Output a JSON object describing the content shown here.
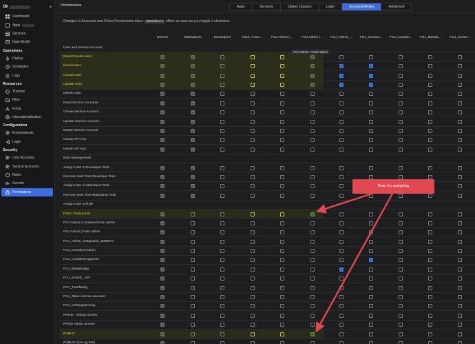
{
  "brand": {
    "logo": "Ok"
  },
  "sidebar": {
    "sections": [
      {
        "items": [
          {
            "label": "Dashboard",
            "icon": "grid-icon"
          },
          {
            "label": "Apps",
            "icon": "apps-icon",
            "blurred": true
          },
          {
            "label": "Services",
            "icon": "server-icon"
          },
          {
            "label": "Data Model",
            "icon": "database-icon"
          }
        ]
      },
      {
        "title": "Operations",
        "items": [
          {
            "label": "Deploy",
            "icon": "rocket-icon"
          },
          {
            "label": "Schedules",
            "icon": "clock-icon"
          },
          {
            "label": "Logs",
            "icon": "list-icon"
          }
        ]
      },
      {
        "title": "Resources",
        "items": [
          {
            "label": "Themes",
            "icon": "palette-icon"
          },
          {
            "label": "Files",
            "icon": "folder-icon"
          },
          {
            "label": "Fonts",
            "icon": "font-icon"
          },
          {
            "label": "Internationalization",
            "icon": "globe-icon"
          }
        ]
      },
      {
        "title": "Configuration",
        "items": [
          {
            "label": "Environments",
            "icon": "layers-icon"
          },
          {
            "label": "Login",
            "icon": "login-icon"
          }
        ]
      },
      {
        "title": "Security",
        "items": [
          {
            "label": "User Accounts",
            "icon": "users-icon"
          },
          {
            "label": "Service Accounts",
            "icon": "users-icon"
          },
          {
            "label": "Roles",
            "icon": "shield-icon"
          },
          {
            "label": "Secrets",
            "icon": "key-icon"
          },
          {
            "label": "Permissions",
            "icon": "lock-icon",
            "active": true
          }
        ]
      }
    ]
  },
  "header": {
    "title": "Permissions"
  },
  "tabs": [
    {
      "label": "Apps"
    },
    {
      "label": "Services"
    },
    {
      "label": "Object Classes"
    },
    {
      "label": "Login"
    },
    {
      "label": "Accounts/Roles",
      "active": true
    },
    {
      "label": "Advanced"
    }
  ],
  "notice": {
    "before": "Changes in Accounts and Roles Permissions takes",
    "code": "immediate",
    "after": "effect as soon as you toggle a checkbox."
  },
  "columns": [
    "Owners",
    "Maintainers",
    "Developers",
    "Fasit | Fasit ...",
    "FGJ Admin | ...",
    "FGJ Admin | ...",
    "FGJ_Admin_...",
    "FGJ_Contain...",
    "FGJ_Contain...",
    "FGJ_Mottak...",
    "FGJ_Sortert..."
  ],
  "tooltip": "FGJ Admin | Fasit admin",
  "colors": {
    "accent": "#3d6be0",
    "highlight_text": "#e4d84a",
    "annotation": "#e24851"
  },
  "rows": [
    {
      "label": "User and Service Account",
      "type": "section"
    },
    {
      "label": "Read Create Users",
      "hl": "full",
      "cells": [
        "d",
        "d",
        "o",
        "y",
        "y",
        "d",
        "o",
        "o",
        "o",
        "o",
        "o"
      ]
    },
    {
      "label": "Read Users",
      "hl": "full",
      "cells": [
        "d",
        "d",
        "o",
        "y",
        "y",
        "d",
        "b",
        "b",
        "o",
        "o",
        "o"
      ]
    },
    {
      "label": "Create User",
      "hl": "full",
      "cells": [
        "d",
        "d",
        "o",
        "y",
        "y",
        "d",
        "b",
        "b",
        "o",
        "o",
        "o"
      ]
    },
    {
      "label": "Update User",
      "hl": "full",
      "cells": [
        "d",
        "d",
        "o",
        "y",
        "y",
        "d",
        "b",
        "b",
        "o",
        "o",
        "o"
      ]
    },
    {
      "label": "Delete User",
      "cells": [
        "d",
        "d",
        "o",
        "o",
        "o",
        "o",
        "o",
        "o",
        "o",
        "o",
        "o"
      ]
    },
    {
      "label": "Read Service Accounts",
      "cells": [
        "d",
        "d",
        "o",
        "o",
        "o",
        "o",
        "o",
        "o",
        "o",
        "o",
        "o"
      ]
    },
    {
      "label": "Create Service Account",
      "cells": [
        "d",
        "d",
        "o",
        "o",
        "o",
        "o",
        "o",
        "o",
        "o",
        "o",
        "o"
      ]
    },
    {
      "label": "Update Service Account",
      "cells": [
        "d",
        "d",
        "o",
        "o",
        "o",
        "o",
        "o",
        "o",
        "o",
        "o",
        "o"
      ]
    },
    {
      "label": "Delete Service Account",
      "cells": [
        "d",
        "d",
        "o",
        "o",
        "o",
        "o",
        "o",
        "o",
        "o",
        "o",
        "o"
      ]
    },
    {
      "label": "Create API Key",
      "cells": [
        "d",
        "d",
        "o",
        "o",
        "o",
        "o",
        "o",
        "o",
        "o",
        "o",
        "o"
      ]
    },
    {
      "label": "Delete API Key",
      "cells": [
        "d",
        "d",
        "o",
        "o",
        "o",
        "o",
        "o",
        "o",
        "o",
        "o",
        "o"
      ]
    },
    {
      "label": "Role Management",
      "type": "section"
    },
    {
      "label": "Assign User to Developer Role",
      "cells": [
        "d",
        "d",
        "o",
        "o",
        "o",
        "o",
        "o",
        "o",
        "o",
        "o",
        "o"
      ]
    },
    {
      "label": "Remove User from Developer Role",
      "cells": [
        "d",
        "d",
        "o",
        "o",
        "o",
        "o",
        "o",
        "o",
        "o",
        "o",
        "o"
      ]
    },
    {
      "label": "Assign User to Maintainer Role",
      "cells": [
        "d",
        "d",
        "o",
        "o",
        "o",
        "o",
        "o",
        "o",
        "o",
        "o",
        "o"
      ]
    },
    {
      "label": "Remove User from Maintainer Role",
      "cells": [
        "d",
        "d",
        "o",
        "o",
        "o",
        "o",
        "o",
        "o",
        "o",
        "o",
        "o"
      ]
    },
    {
      "label": "Assign User to Role",
      "type": "section"
    },
    {
      "label": "Fasit | Fasit portal",
      "hl": "sel",
      "cells": [
        "d",
        "o",
        "o",
        "y",
        "y",
        "g",
        "o",
        "o",
        "o",
        "o",
        "o"
      ]
    },
    {
      "label": "FGJ Admin | ContainerScan admin",
      "cells": [
        "d",
        "o",
        "o",
        "o",
        "o",
        "o",
        "o",
        "o",
        "o",
        "o",
        "o"
      ]
    },
    {
      "label": "FGJ Admin | Fasit admin",
      "cells": [
        "d",
        "o",
        "o",
        "o",
        "o",
        "o",
        "o",
        "o",
        "o",
        "o",
        "o"
      ]
    },
    {
      "label": "FGJ_Admin_Integration_D365FO",
      "cells": [
        "d",
        "o",
        "o",
        "o",
        "o",
        "o",
        "o",
        "o",
        "o",
        "o",
        "o"
      ]
    },
    {
      "label": "FGJ_ContainerAdmin",
      "cells": [
        "d",
        "o",
        "o",
        "o",
        "o",
        "o",
        "o",
        "o",
        "o",
        "o",
        "o"
      ]
    },
    {
      "label": "FGJ_ContainerAppUser",
      "cells": [
        "d",
        "o",
        "o",
        "o",
        "o",
        "o",
        "o",
        "b",
        "o",
        "o",
        "o"
      ]
    },
    {
      "label": "FGJ_Mottaksapp",
      "cells": [
        "d",
        "o",
        "o",
        "o",
        "o",
        "o",
        "b",
        "o",
        "o",
        "o",
        "o"
      ]
    },
    {
      "label": "FGJ_Sortert_ API",
      "cells": [
        "d",
        "o",
        "o",
        "o",
        "o",
        "o",
        "o",
        "o",
        "o",
        "o",
        "o"
      ]
    },
    {
      "label": "FGJ_Timeføring",
      "cells": [
        "d",
        "o",
        "o",
        "o",
        "o",
        "o",
        "o",
        "o",
        "o",
        "o",
        "o"
      ]
    },
    {
      "label": "FGJ_Token service account",
      "cells": [
        "d",
        "o",
        "o",
        "o",
        "o",
        "o",
        "o",
        "o",
        "o",
        "o",
        "o"
      ]
    },
    {
      "label": "FGJ_Vektregistrering",
      "cells": [
        "d",
        "o",
        "o",
        "o",
        "o",
        "o",
        "o",
        "o",
        "o",
        "o",
        "o"
      ]
    },
    {
      "label": "PROD - Debug access",
      "cells": [
        "d",
        "o",
        "o",
        "o",
        "o",
        "o",
        "o",
        "o",
        "o",
        "o",
        "o"
      ]
    },
    {
      "label": "PROD Admin access",
      "cells": [
        "d",
        "o",
        "o",
        "o",
        "o",
        "o",
        "o",
        "o",
        "o",
        "o",
        "o"
      ]
    },
    {
      "label": "PUBLIC",
      "hl": "sel",
      "cells": [
        "d",
        "o",
        "o",
        "y",
        "y",
        "g",
        "o",
        "o",
        "o",
        "o",
        "o"
      ]
    },
    {
      "label": "PUBLIC (dev og test)",
      "cells": [
        "d",
        "o",
        "o",
        "o",
        "o",
        "o",
        "o",
        "o",
        "o",
        "o",
        "o"
      ]
    }
  ],
  "annotation": {
    "label": "Role I'm assigning"
  }
}
